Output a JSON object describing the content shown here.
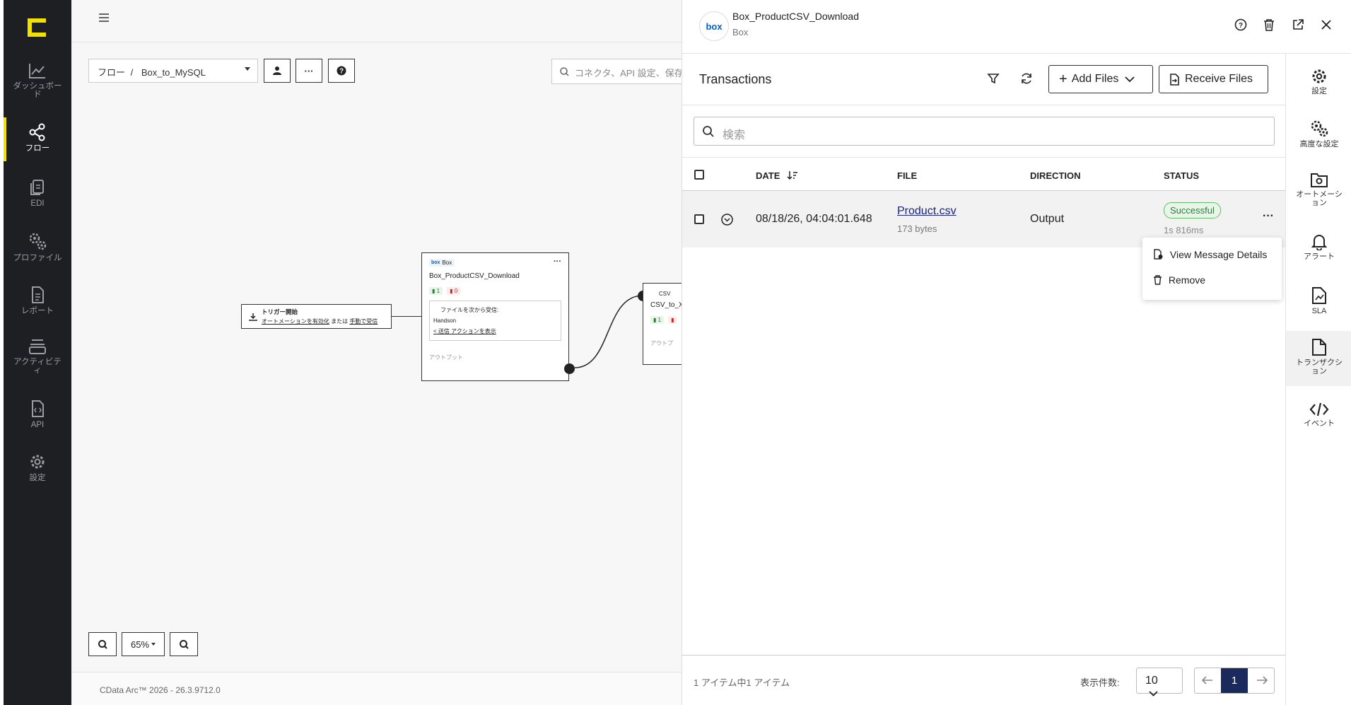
{
  "nav": {
    "items": [
      {
        "label": "ダッシュボード",
        "icon": "chart-line-icon"
      },
      {
        "label": "フロー",
        "icon": "share-nodes-icon"
      },
      {
        "label": "EDI",
        "icon": "documents-icon"
      },
      {
        "label": "プロファイル",
        "icon": "gears-icon"
      },
      {
        "label": "レポート",
        "icon": "file-lines-icon"
      },
      {
        "label": "アクティビティ",
        "icon": "layers-icon"
      },
      {
        "label": "API",
        "icon": "file-code-icon"
      },
      {
        "label": "設定",
        "icon": "gear-icon"
      }
    ],
    "active": "フロー"
  },
  "canvas": {
    "breadcrumb_root": "フロー",
    "breadcrumb_sep": "/",
    "flow_name": "Box_to_MySQL",
    "search_placeholder": "コネクタ、API 設定、保存",
    "zoom": "65%",
    "more_label": "···",
    "trigger": {
      "title": "トリガー開始",
      "line_a": "オートメーションを有効化",
      "line_mid": "または",
      "line_b": "手動で受信"
    },
    "box_node": {
      "badge": "Box",
      "badge_logo": "box",
      "name": "Box_ProductCSV_Download",
      "count_ok": "1",
      "count_err": "0",
      "recv_label": "ファイルを次から受信:",
      "recv_from": "Handson",
      "action_link": "送信 アクションを表示",
      "output_label": "アウトプット"
    },
    "csv_node": {
      "badge": "CSV",
      "name": "CSV_to_XM",
      "count_ok": "1",
      "output_label": "アウトプ"
    },
    "footer": "CData Arc™ 2026 - 26.3.9712.0"
  },
  "panel": {
    "connector_name": "Box_ProductCSV_Download",
    "connector_type": "Box",
    "logo_text": "box",
    "transactions_title": "Transactions",
    "add_files": "Add Files",
    "receive_files": "Receive Files",
    "search_placeholder": "検索",
    "columns": {
      "date": "DATE",
      "file": "FILE",
      "direction": "DIRECTION",
      "status": "STATUS"
    },
    "rows": [
      {
        "date": "08/18/26, 04:04:01.648",
        "file": "Product.csv",
        "size": "173 bytes",
        "direction": "Output",
        "status": "Successful",
        "duration": "1s 816ms"
      }
    ],
    "row_menu": [
      "View Message Details",
      "Remove"
    ],
    "footer_count": "1 アイテム中1 アイテム",
    "page_size_label": "表示件数:",
    "page_size": "10",
    "current_page": "1",
    "colors": {
      "success": "#2e7d32",
      "success_bg": "#e8f5e9",
      "page_active": "#1a2a5c",
      "accent": "#f1e100"
    }
  },
  "rightbar": [
    {
      "label": "設定",
      "icon": "gear-icon"
    },
    {
      "label": "高度な設定",
      "icon": "gears-icon"
    },
    {
      "label": "オートメーション",
      "icon": "folder-gear-icon"
    },
    {
      "label": "アラート",
      "icon": "bell-icon"
    },
    {
      "label": "SLA",
      "icon": "file-chart-icon"
    },
    {
      "label": "トランザクション",
      "icon": "file-icon"
    },
    {
      "label": "イベント",
      "icon": "code-icon"
    }
  ]
}
